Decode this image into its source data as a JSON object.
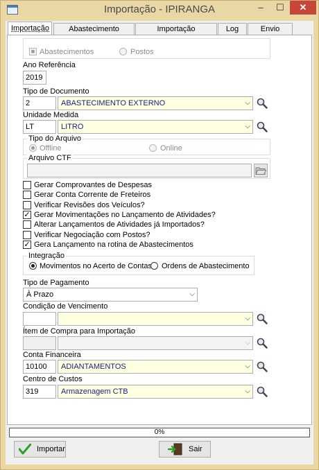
{
  "window": {
    "title": "Importação - IPIRANGA",
    "minimize": "–",
    "maximize": "☐",
    "close": "✕"
  },
  "tabs": [
    "Importação",
    "Abastecimento Interno",
    "Importação Automática",
    "Log",
    "Envio Email"
  ],
  "source": {
    "opt1": "Abastecimentos",
    "opt2": "Postos",
    "selected": "Abastecimentos"
  },
  "ano_referencia": {
    "label": "Ano Referência",
    "value": "2019"
  },
  "tipo_documento": {
    "label": "Tipo de Documento",
    "code": "2",
    "value": "ABASTECIMENTO EXTERNO"
  },
  "unidade_medida": {
    "label": "Unidade Medida",
    "code": "LT",
    "value": "LITRO"
  },
  "tipo_arquivo": {
    "label": "Tipo do Arquivo",
    "opt1": "Offline",
    "opt2": "Online",
    "selected": "Offline"
  },
  "arquivo_ctf": {
    "label": "Arquivo CTF",
    "value": ""
  },
  "options": [
    {
      "label": "Gerar Comprovantes de Despesas",
      "checked": false
    },
    {
      "label": "Gerar Conta Corrente de Freteiros",
      "checked": false
    },
    {
      "label": "Verificar Revisões dos Veículos?",
      "checked": false
    },
    {
      "label": "Gerar Movimentações no Lançamento de Atividades?",
      "checked": true
    },
    {
      "label": "Alterar Lançamentos de Atividades já Importados?",
      "checked": false
    },
    {
      "label": "Verificar Negociação com Postos?",
      "checked": false
    },
    {
      "label": "Gera Lançamento na rotina de Abastecimentos",
      "checked": true
    }
  ],
  "integracao": {
    "label": "Integração",
    "opt1": "Movimentos no Acerto de Contas",
    "opt2": "Ordens de Abastecimento",
    "selected": "Movimentos no Acerto de Contas"
  },
  "tipo_pagamento": {
    "label": "Tipo de Pagamento",
    "value": "À Prazo"
  },
  "condicao_vencimento": {
    "label": "Condição de Vencimento",
    "code": "",
    "value": ""
  },
  "item_compra": {
    "label": "Ítem de Compra para Importação",
    "code": "",
    "value": ""
  },
  "conta_financeira": {
    "label": "Conta Financeira",
    "code": "10100",
    "value": "ADIANTAMENTOS"
  },
  "centro_custos": {
    "label": "Centro de Custos",
    "code": "319",
    "value": "Armazenagem CTB"
  },
  "progress": {
    "text": "0%",
    "value": 0
  },
  "buttons": {
    "importar": "Importar",
    "sair": "Sair"
  },
  "colors": {
    "frame": "#ead7a6",
    "combo_bg": "#ffffe1",
    "combo_text": "#1a237e",
    "close": "#c7463a"
  }
}
